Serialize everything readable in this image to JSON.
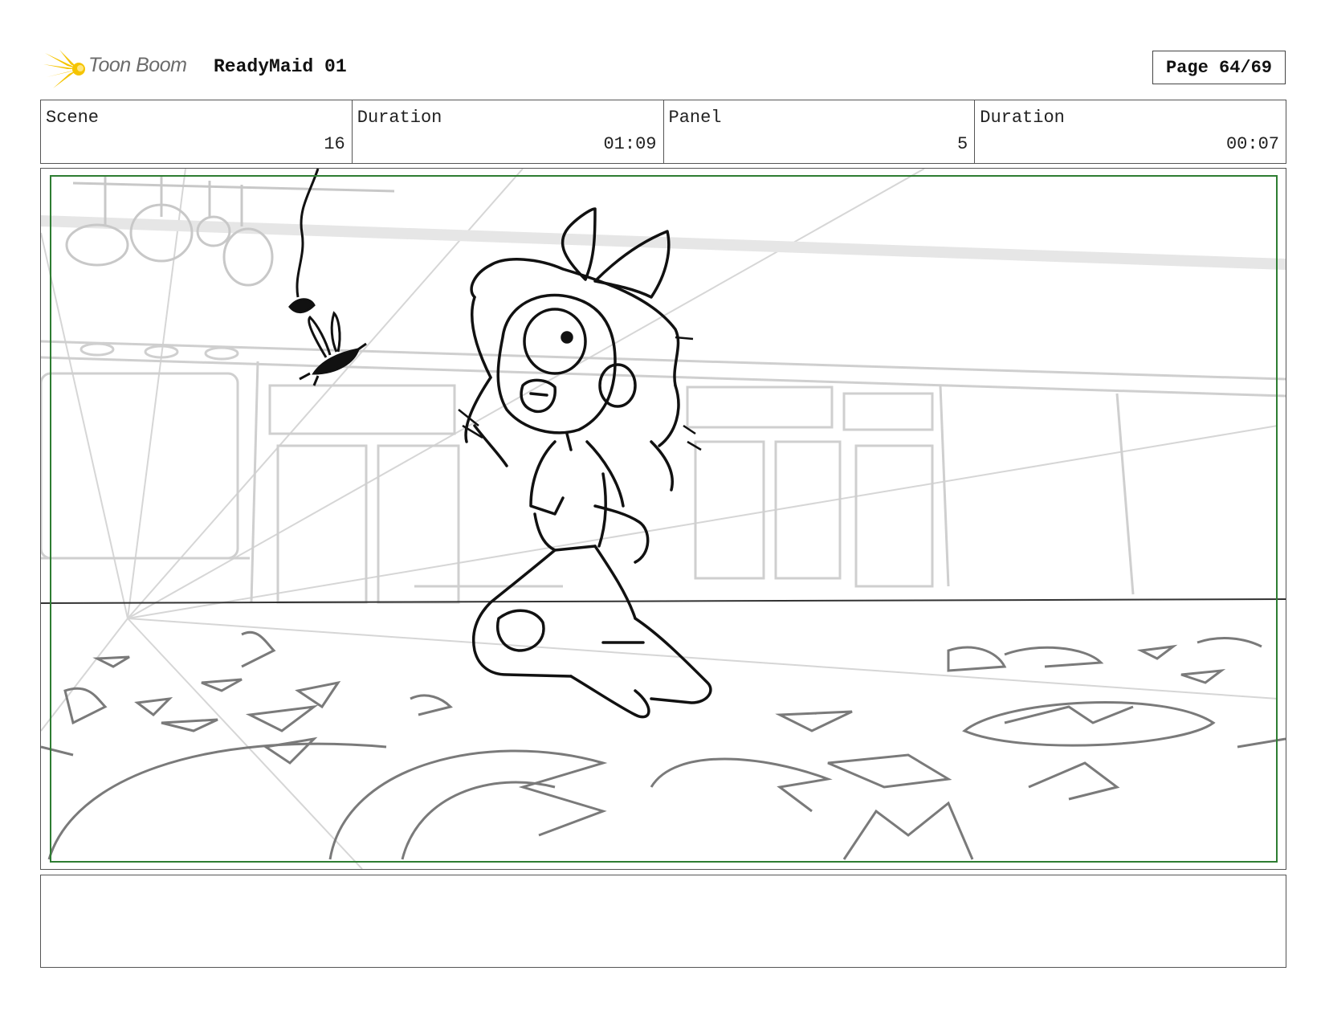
{
  "header": {
    "logo_text": "Toon Boom",
    "project_title": "ReadyMaid 01",
    "page_label": "Page 64/69"
  },
  "info": {
    "scene_label": "Scene",
    "scene_value": "16",
    "scene_duration_label": "Duration",
    "scene_duration_value": "01:09",
    "panel_label": "Panel",
    "panel_value": "5",
    "panel_duration_label": "Duration",
    "panel_duration_value": "00:07"
  },
  "colors": {
    "safe_area": "#2e7d32",
    "logo_flare": "#f5c400",
    "logo_text": "#6b6b6b"
  },
  "notes": {
    "text": ""
  }
}
